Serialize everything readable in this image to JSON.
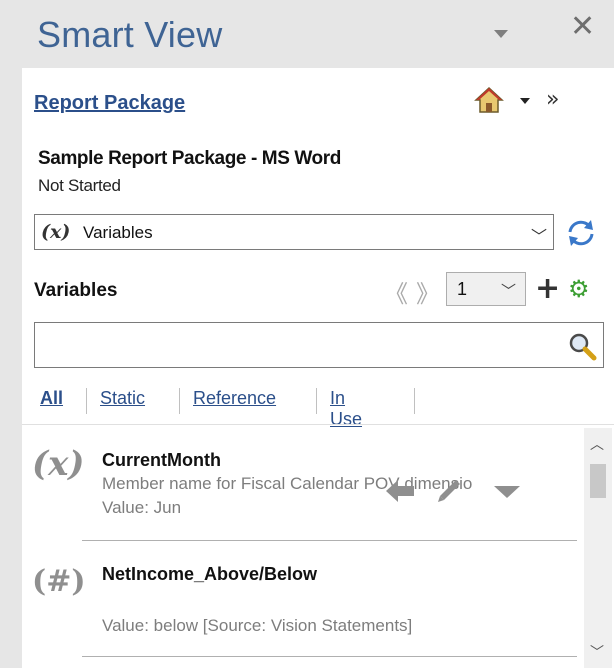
{
  "panel": {
    "title": "Smart View"
  },
  "header": {
    "link": "Report Package"
  },
  "package": {
    "name": "Sample Report Package - MS Word",
    "status": "Not Started"
  },
  "selector": {
    "icon_text": "(x)",
    "value": "Variables"
  },
  "variables": {
    "label": "Variables",
    "page": "1"
  },
  "search": {
    "value": "",
    "placeholder": ""
  },
  "filters": [
    "All",
    "Static",
    "Reference",
    "In Use"
  ],
  "items": [
    {
      "icon_text": "(x)",
      "name": "CurrentMonth",
      "description": "Member name for Fiscal Calendar POV dimensio",
      "value": "Value: Jun"
    },
    {
      "icon_text": "(#)",
      "name": "NetIncome_Above/Below",
      "description": "",
      "value": "Value: below [Source: Vision Statements]"
    }
  ],
  "colors": {
    "title": "#3f6494",
    "link": "#2b4f8a",
    "gear": "#3c9e33",
    "background": "#e6e6e6"
  }
}
